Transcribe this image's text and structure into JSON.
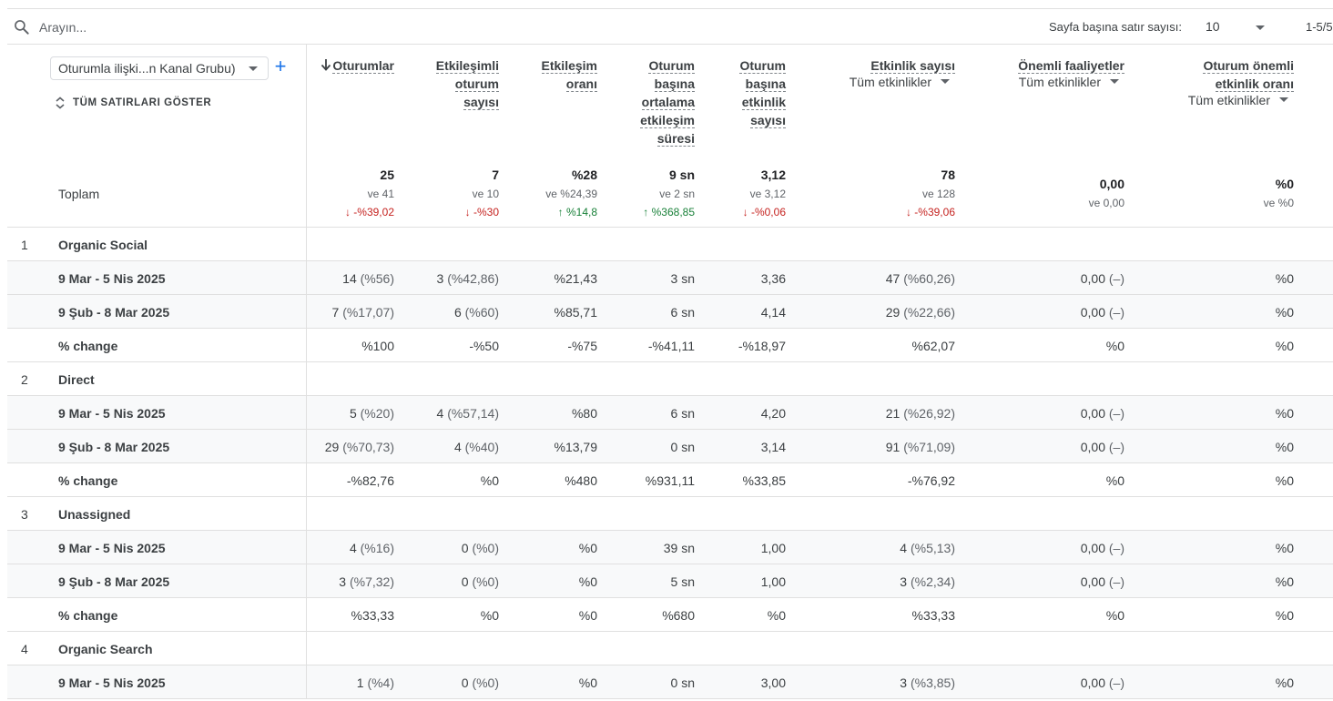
{
  "toolbar": {
    "search_placeholder": "Arayın...",
    "rows_per_page_label": "Sayfa başına satır sayısı:",
    "rows_per_page_value": "10",
    "pagination": "1-5/5"
  },
  "dimension": {
    "selector_value": "Oturumla ilişki...n Kanal Grubu)",
    "add_icon": "plus-icon",
    "show_all_rows": "TÜM SATIRLARI GÖSTER",
    "total_label": "Toplam"
  },
  "columns": [
    {
      "key": "sessions",
      "title_lines": [
        "Oturumlar"
      ],
      "sorted": "descending"
    },
    {
      "key": "engaged_sessions",
      "title_lines": [
        "Etkileşimli",
        "oturum",
        "sayısı"
      ]
    },
    {
      "key": "engagement_rate",
      "title_lines": [
        "Etkileşim",
        "oranı"
      ]
    },
    {
      "key": "avg_engagement_time",
      "title_lines": [
        "Oturum",
        "başına",
        "ortalama",
        "etkileşim",
        "süresi"
      ]
    },
    {
      "key": "events_per_session",
      "title_lines": [
        "Oturum",
        "başına",
        "etkinlik",
        "sayısı"
      ]
    },
    {
      "key": "event_count",
      "title_lines": [
        "Etkinlik sayısı"
      ],
      "filter": "Tüm etkinlikler"
    },
    {
      "key": "key_events",
      "title_lines": [
        "Önemli faaliyetler"
      ],
      "filter": "Tüm etkinlikler"
    },
    {
      "key": "session_key_event_rate",
      "title_lines": [
        "Oturum önemli",
        "etkinlik oranı"
      ],
      "filter": "Tüm etkinlikler"
    }
  ],
  "totals": [
    {
      "value": "25",
      "compare": "ve 41",
      "delta": "-%39,02",
      "direction": "down"
    },
    {
      "value": "7",
      "compare": "ve 10",
      "delta": "-%30",
      "direction": "down"
    },
    {
      "value": "%28",
      "compare": "ve %24,39",
      "delta": "%14,8",
      "direction": "up"
    },
    {
      "value": "9 sn",
      "compare": "ve 2 sn",
      "delta": "%368,85",
      "direction": "up"
    },
    {
      "value": "3,12",
      "compare": "ve 3,12",
      "delta": "-%0,06",
      "direction": "down"
    },
    {
      "value": "78",
      "compare": "ve 128",
      "delta": "-%39,06",
      "direction": "down"
    },
    {
      "value": "0,00",
      "compare": "ve 0,00"
    },
    {
      "value": "%0",
      "compare": "ve %0"
    }
  ],
  "groups": [
    {
      "num": "1",
      "name": "Organic Social",
      "rows": [
        {
          "label": "9 Mar - 5 Nis 2025",
          "cells": [
            {
              "v": "14",
              "p": "(%56)"
            },
            {
              "v": "3",
              "p": "(%42,86)"
            },
            {
              "v": "%21,43"
            },
            {
              "v": "3 sn"
            },
            {
              "v": "3,36"
            },
            {
              "v": "47",
              "p": "(%60,26)"
            },
            {
              "v": "0,00",
              "p": "(–)"
            },
            {
              "v": "%0"
            }
          ]
        },
        {
          "label": "9 Şub - 8 Mar 2025",
          "cells": [
            {
              "v": "7",
              "p": "(%17,07)"
            },
            {
              "v": "6",
              "p": "(%60)"
            },
            {
              "v": "%85,71"
            },
            {
              "v": "6 sn"
            },
            {
              "v": "4,14"
            },
            {
              "v": "29",
              "p": "(%22,66)"
            },
            {
              "v": "0,00",
              "p": "(–)"
            },
            {
              "v": "%0"
            }
          ]
        },
        {
          "label": "% change",
          "cells": [
            {
              "v": "%100"
            },
            {
              "v": "-%50"
            },
            {
              "v": "-%75"
            },
            {
              "v": "-%41,11"
            },
            {
              "v": "-%18,97"
            },
            {
              "v": "%62,07"
            },
            {
              "v": "%0"
            },
            {
              "v": "%0"
            }
          ]
        }
      ]
    },
    {
      "num": "2",
      "name": "Direct",
      "rows": [
        {
          "label": "9 Mar - 5 Nis 2025",
          "cells": [
            {
              "v": "5",
              "p": "(%20)"
            },
            {
              "v": "4",
              "p": "(%57,14)"
            },
            {
              "v": "%80"
            },
            {
              "v": "6 sn"
            },
            {
              "v": "4,20"
            },
            {
              "v": "21",
              "p": "(%26,92)"
            },
            {
              "v": "0,00",
              "p": "(–)"
            },
            {
              "v": "%0"
            }
          ]
        },
        {
          "label": "9 Şub - 8 Mar 2025",
          "cells": [
            {
              "v": "29",
              "p": "(%70,73)"
            },
            {
              "v": "4",
              "p": "(%40)"
            },
            {
              "v": "%13,79"
            },
            {
              "v": "0 sn"
            },
            {
              "v": "3,14"
            },
            {
              "v": "91",
              "p": "(%71,09)"
            },
            {
              "v": "0,00",
              "p": "(–)"
            },
            {
              "v": "%0"
            }
          ]
        },
        {
          "label": "% change",
          "cells": [
            {
              "v": "-%82,76"
            },
            {
              "v": "%0"
            },
            {
              "v": "%480"
            },
            {
              "v": "%931,11"
            },
            {
              "v": "%33,85"
            },
            {
              "v": "-%76,92"
            },
            {
              "v": "%0"
            },
            {
              "v": "%0"
            }
          ]
        }
      ]
    },
    {
      "num": "3",
      "name": "Unassigned",
      "rows": [
        {
          "label": "9 Mar - 5 Nis 2025",
          "cells": [
            {
              "v": "4",
              "p": "(%16)"
            },
            {
              "v": "0",
              "p": "(%0)"
            },
            {
              "v": "%0"
            },
            {
              "v": "39 sn"
            },
            {
              "v": "1,00"
            },
            {
              "v": "4",
              "p": "(%5,13)"
            },
            {
              "v": "0,00",
              "p": "(–)"
            },
            {
              "v": "%0"
            }
          ]
        },
        {
          "label": "9 Şub - 8 Mar 2025",
          "cells": [
            {
              "v": "3",
              "p": "(%7,32)"
            },
            {
              "v": "0",
              "p": "(%0)"
            },
            {
              "v": "%0"
            },
            {
              "v": "5 sn"
            },
            {
              "v": "1,00"
            },
            {
              "v": "3",
              "p": "(%2,34)"
            },
            {
              "v": "0,00",
              "p": "(–)"
            },
            {
              "v": "%0"
            }
          ]
        },
        {
          "label": "% change",
          "cells": [
            {
              "v": "%33,33"
            },
            {
              "v": "%0"
            },
            {
              "v": "%0"
            },
            {
              "v": "%680"
            },
            {
              "v": "%0"
            },
            {
              "v": "%33,33"
            },
            {
              "v": "%0"
            },
            {
              "v": "%0"
            }
          ]
        }
      ]
    },
    {
      "num": "4",
      "name": "Organic Search",
      "rows": [
        {
          "label": "9 Mar - 5 Nis 2025",
          "cells": [
            {
              "v": "1",
              "p": "(%4)"
            },
            {
              "v": "0",
              "p": "(%0)"
            },
            {
              "v": "%0"
            },
            {
              "v": "0 sn"
            },
            {
              "v": "3,00"
            },
            {
              "v": "3",
              "p": "(%3,85)"
            },
            {
              "v": "0,00",
              "p": "(–)"
            },
            {
              "v": "%0"
            }
          ]
        }
      ]
    }
  ],
  "colors": {
    "accent": "#1a73e8",
    "negative": "#c5221f",
    "positive": "#188038",
    "row_shade": "#f8f9fa",
    "divider": "#e0e0e0"
  }
}
